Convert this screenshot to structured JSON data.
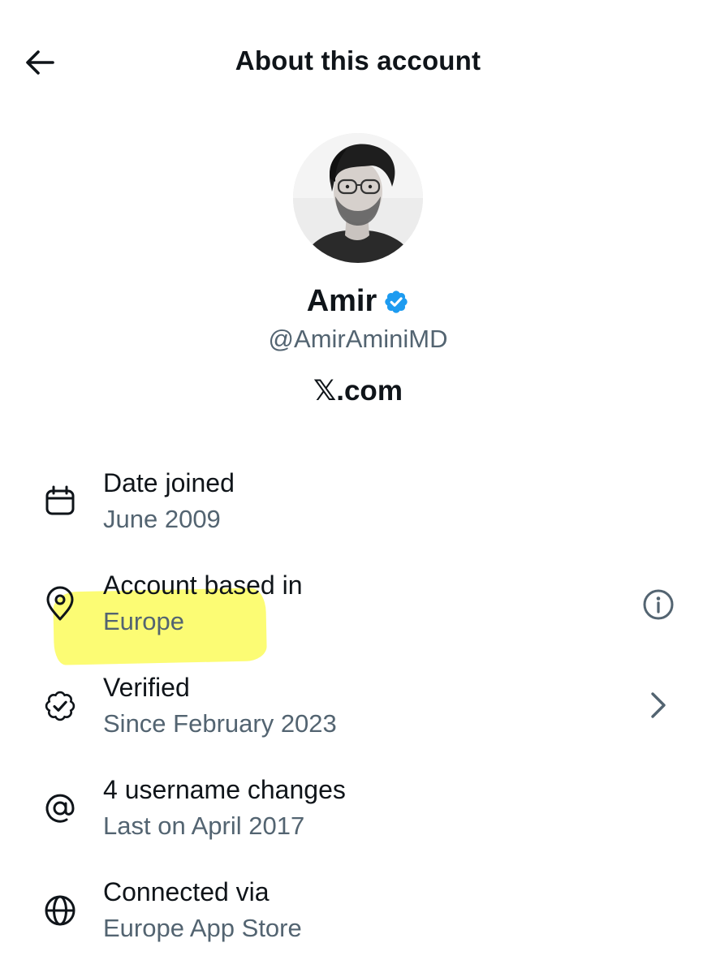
{
  "header": {
    "title": "About this account",
    "back_icon": "arrow-left-icon"
  },
  "profile": {
    "name": "Amir",
    "verified": true,
    "handle": "@AmirAminiMD",
    "site": "𝕏.com",
    "accent_color": "#1d9bf0"
  },
  "details": [
    {
      "icon": "calendar-icon",
      "label": "Date joined",
      "value": "June 2009"
    },
    {
      "icon": "location-pin-icon",
      "label": "Account based in",
      "value": "Europe",
      "right_icon": "info-icon",
      "highlighted": true,
      "highlight_color": "#fafa1e"
    },
    {
      "icon": "verified-badge-outline-icon",
      "label": "Verified",
      "value": "Since February 2023",
      "right_icon": "chevron-right-icon"
    },
    {
      "icon": "at-sign-icon",
      "label": "4 username changes",
      "value": "Last on April 2017"
    },
    {
      "icon": "globe-icon",
      "label": "Connected via",
      "value": "Europe App Store"
    }
  ],
  "colors": {
    "text_primary": "#0f1419",
    "text_secondary": "#536471"
  }
}
